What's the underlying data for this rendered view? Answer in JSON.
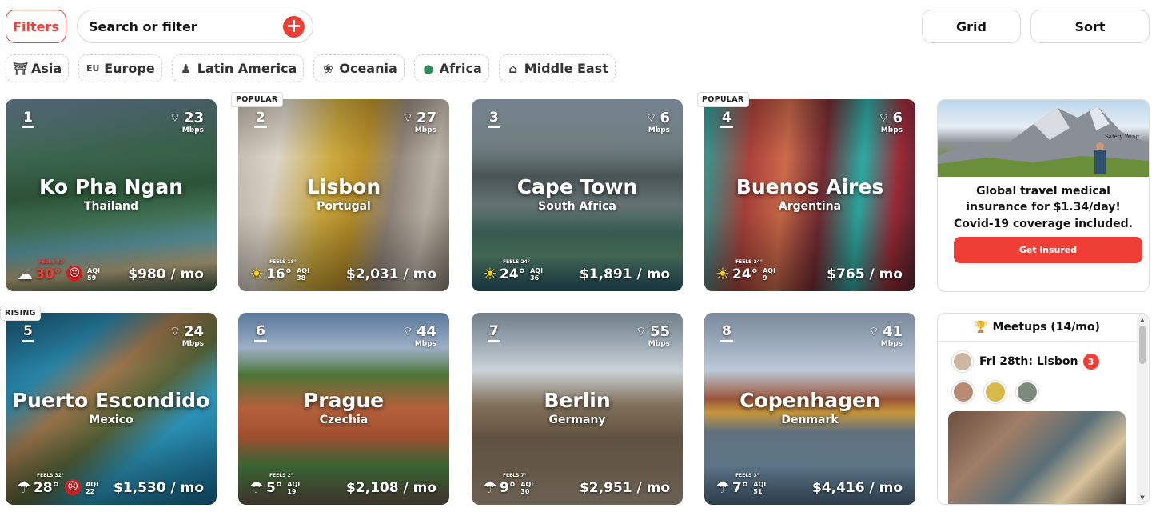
{
  "toolbar": {
    "filters_label": "Filters",
    "search_placeholder": "Search or filter",
    "grid_label": "Grid",
    "sort_label": "Sort"
  },
  "regions": [
    {
      "label": "Asia",
      "icon": "torii-gate-icon"
    },
    {
      "label": "Europe",
      "icon": "eu-flag-icon",
      "prefix": "EU"
    },
    {
      "label": "Latin America",
      "icon": "latin-america-icon"
    },
    {
      "label": "Oceania",
      "icon": "oceania-icon"
    },
    {
      "label": "Africa",
      "icon": "globe-africa-icon"
    },
    {
      "label": "Middle East",
      "icon": "mosque-icon"
    }
  ],
  "cities": [
    {
      "rank": "1",
      "city": "Ko Pha Ngan",
      "country": "Thailand",
      "wifi": "23",
      "wifi_unit": "Mbps",
      "feels": "FEELS 32°",
      "temp": "30°",
      "aqi_label": "AQI",
      "aqi": "59",
      "price": "$980 / mo",
      "weather": "cloud-sun-icon"
    },
    {
      "rank": "2",
      "city": "Lisbon",
      "country": "Portugal",
      "wifi": "27",
      "wifi_unit": "Mbps",
      "feels": "FEELS 18°",
      "temp": "16°",
      "aqi_label": "AQI",
      "aqi": "38",
      "price": "$2,031 / mo",
      "weather": "sun-icon",
      "tag": "POPULAR"
    },
    {
      "rank": "3",
      "city": "Cape Town",
      "country": "South Africa",
      "wifi": "6",
      "wifi_unit": "Mbps",
      "feels": "FEELS 24°",
      "temp": "24°",
      "aqi_label": "AQI",
      "aqi": "36",
      "price": "$1,891 / mo",
      "weather": "sun-icon"
    },
    {
      "rank": "4",
      "city": "Buenos Aires",
      "country": "Argentina",
      "wifi": "6",
      "wifi_unit": "Mbps",
      "feels": "FEELS 24°",
      "temp": "24°",
      "aqi_label": "AQI",
      "aqi": "9",
      "price": "$765 / mo",
      "weather": "sun-icon",
      "tag": "POPULAR"
    },
    {
      "rank": "5",
      "city": "Puerto Escondido",
      "country": "Mexico",
      "wifi": "24",
      "wifi_unit": "Mbps",
      "feels": "FEELS 32°",
      "temp": "28°",
      "aqi_label": "AQI",
      "aqi": "22",
      "price": "$1,530 / mo",
      "weather": "rain-cloud-icon",
      "tag": "RISING"
    },
    {
      "rank": "6",
      "city": "Prague",
      "country": "Czechia",
      "wifi": "44",
      "wifi_unit": "Mbps",
      "feels": "FEELS 2°",
      "temp": "5°",
      "aqi_label": "AQI",
      "aqi": "19",
      "price": "$2,108 / mo",
      "weather": "rain-cloud-icon"
    },
    {
      "rank": "7",
      "city": "Berlin",
      "country": "Germany",
      "wifi": "55",
      "wifi_unit": "Mbps",
      "feels": "FEELS 7°",
      "temp": "9°",
      "aqi_label": "AQI",
      "aqi": "30",
      "price": "$2,951 / mo",
      "weather": "rain-cloud-icon"
    },
    {
      "rank": "8",
      "city": "Copenhagen",
      "country": "Denmark",
      "wifi": "41",
      "wifi_unit": "Mbps",
      "feels": "FEELS 3°",
      "temp": "7°",
      "aqi_label": "AQI",
      "aqi": "51",
      "price": "$4,416 / mo",
      "weather": "rain-cloud-icon"
    }
  ],
  "ad": {
    "brand": "Safety Wing",
    "text": "Global travel medical insurance for $1.34/day! Covid-19 coverage included.",
    "button": "Get insured"
  },
  "meetups": {
    "title": "Meetups (14/mo)",
    "event": "Fri 28th: Lisbon",
    "badge": "3"
  },
  "colors": {
    "accent": "#ef3e36",
    "hot_temp": "#ff3b2f"
  }
}
